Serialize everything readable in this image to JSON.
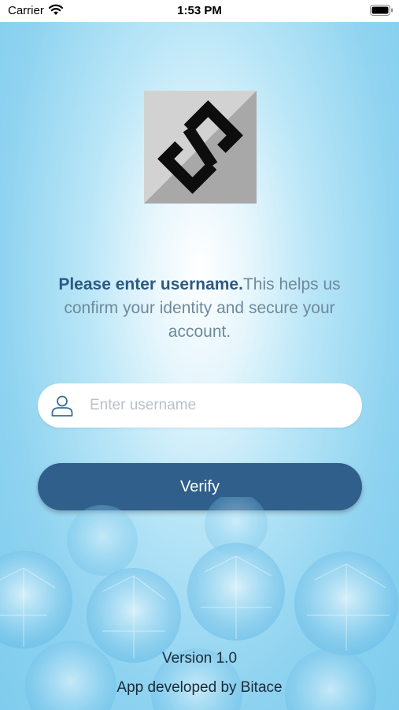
{
  "status_bar": {
    "carrier": "Carrier",
    "time": "1:53 PM"
  },
  "login": {
    "message_bold": "Please enter username.",
    "message_rest": "This helps us confirm your identity and secure your account.",
    "username_placeholder": "Enter username",
    "username_value": "",
    "verify_label": "Verify"
  },
  "footer": {
    "version": "Version 1.0",
    "developer": "App developed by Bitace"
  },
  "icons": [
    "wifi-icon",
    "battery-icon",
    "app-logo",
    "user-icon"
  ],
  "colors": {
    "accent": "#2f5f8a",
    "bold_text": "#2c5a82",
    "body_text": "#6f8a9c",
    "background": "#8fd3f0"
  }
}
